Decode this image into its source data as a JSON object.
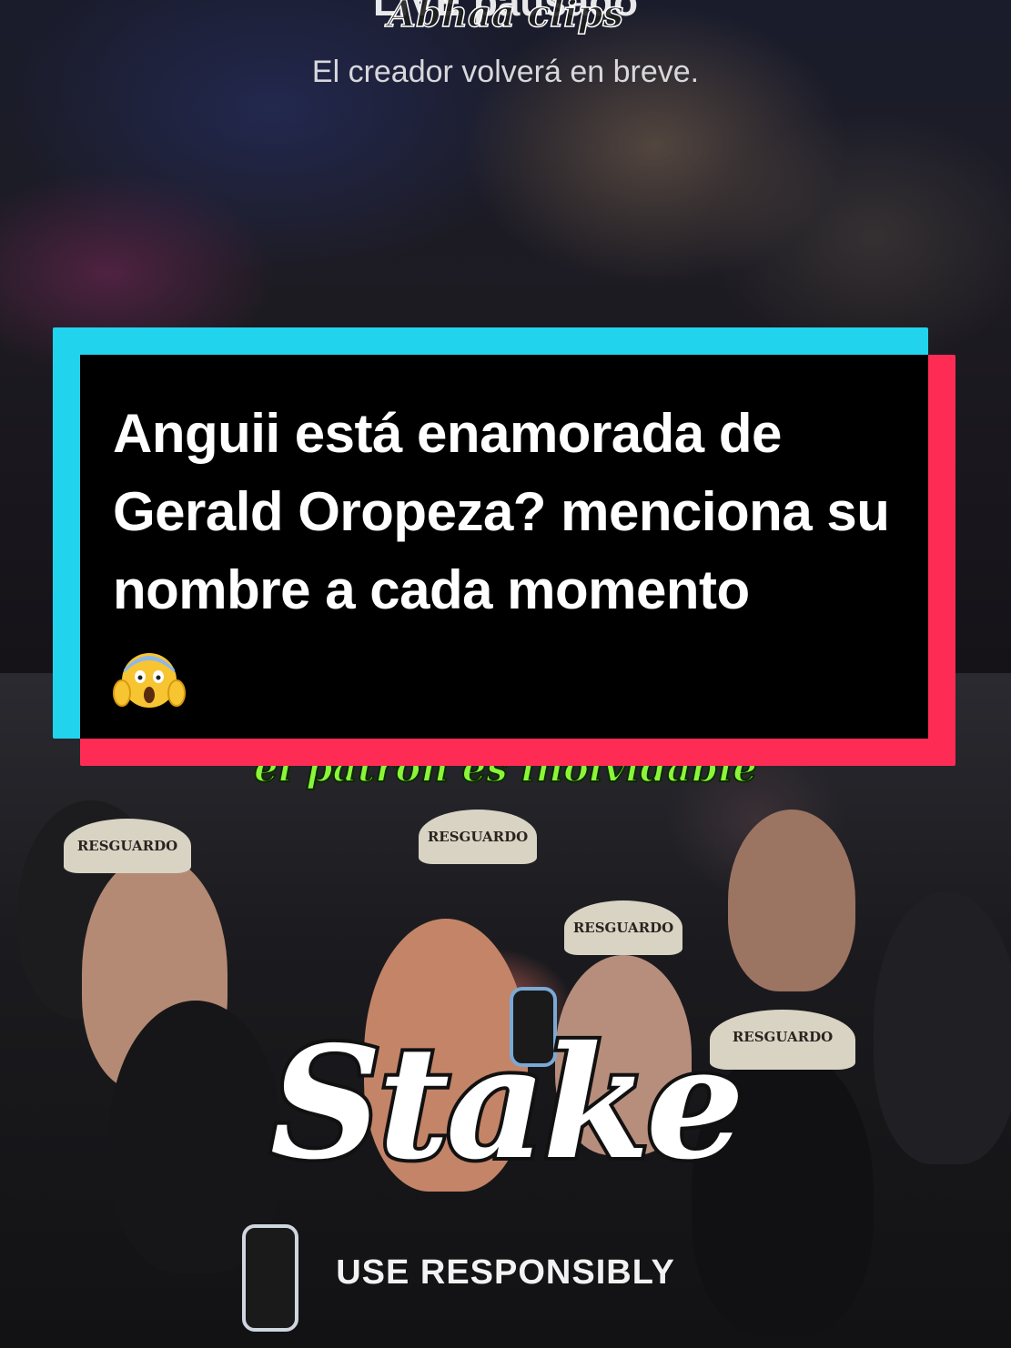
{
  "live": {
    "title": "LIVE pausado",
    "watermark": "Abhaa clips",
    "subtitle": "El creador volverá en breve."
  },
  "caption": {
    "text": "Anguii está enamorada de Gerald Oropeza? menciona su nombre a cada momento",
    "emoji": "face-screaming-in-fear-icon"
  },
  "video": {
    "overlay_caption": "el patron es inolvidable",
    "cap_text": "RESGUARDO"
  },
  "sponsor": {
    "logo": "Stake",
    "tagline": "USE RESPONSIBLY"
  },
  "colors": {
    "cyan": "#22d3ee",
    "red": "#fe2c55",
    "green_caption": "#8cf53a"
  }
}
